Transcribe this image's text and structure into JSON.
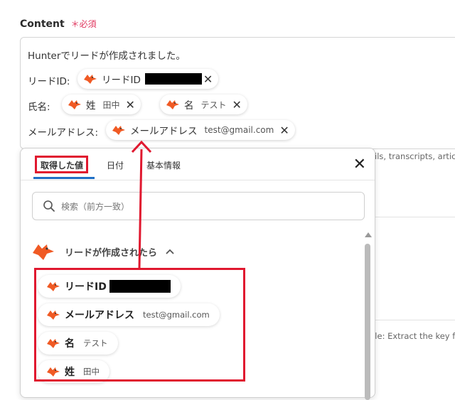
{
  "field": {
    "label": "Content",
    "required_mark": "＊",
    "required_text": "必須"
  },
  "editor": {
    "intro_line": "Hunterでリードが作成されました。",
    "rows": [
      {
        "label": "リードID:",
        "pill_name": "リードID"
      },
      {
        "label": "氏名:",
        "pill_last": "姓",
        "pill_last_val": "田中",
        "pill_first": "名",
        "pill_first_val": "テスト"
      },
      {
        "label": "メールアドレス:",
        "pill_name": "メールアドレス",
        "pill_val": "test@gmail.com"
      }
    ]
  },
  "background": {
    "snippet_1": "ails, transcripts, artic",
    "snippet_2": "ple: Extract the key f"
  },
  "panel": {
    "tabs": [
      {
        "label": "取得した値"
      },
      {
        "label": "日付"
      },
      {
        "label": "基本情報"
      }
    ],
    "close_glyph": "✕",
    "search_placeholder": "検索（前方一致）",
    "section_title": "リードが作成されたら",
    "section_chevron": "^",
    "items": [
      {
        "name": "リードID",
        "value": ""
      },
      {
        "name": "メールアドレス",
        "value": "test@gmail.com"
      },
      {
        "name": "名",
        "value": "テスト"
      },
      {
        "name": "姓",
        "value": "田中"
      }
    ]
  },
  "icons": {
    "fox": "fox-logo-icon",
    "search": "search-icon",
    "close": "close-icon",
    "remove": "remove-tag-icon"
  },
  "colors": {
    "highlight": "#e0182f",
    "tab_underline": "#1f6fc5",
    "required": "#e0365e",
    "fox": "#f05a24"
  }
}
